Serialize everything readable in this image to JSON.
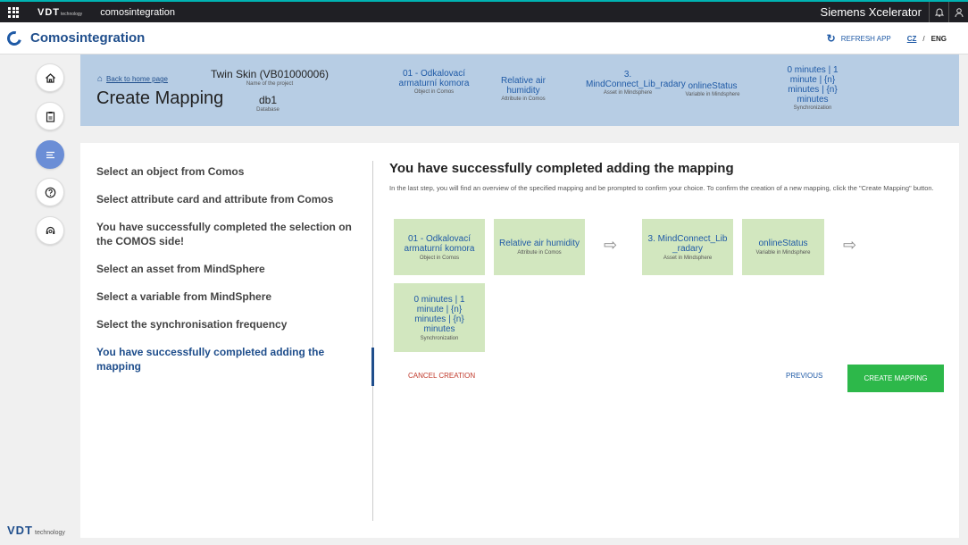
{
  "topbar": {
    "logo": "VDT",
    "logo_sub": "technology",
    "app_name": "comosintegration",
    "brand": "Siemens Xcelerator",
    "icons": [
      "grid-icon",
      "bell-icon",
      "user-icon"
    ]
  },
  "header": {
    "title": "Comosintegration",
    "refresh_label": "REFRESH APP",
    "lang_cz": "CZ",
    "lang_sep": "/",
    "lang_eng": "ENG"
  },
  "rail": {
    "icons": [
      "home-icon",
      "clipboard-icon",
      "list-icon",
      "help-icon",
      "support-icon"
    ]
  },
  "info": {
    "back_link": "Back to home page",
    "page_title": "Create Mapping",
    "project_value": "Twin Skin (VB01000006)",
    "project_label": "Name of the project",
    "db_value": "db1",
    "db_label": "Database",
    "object_value": "01 - Odkalovací armaturní komora",
    "object_label": "Object in Comos",
    "attribute_value": "Relative air humidity",
    "attribute_label": "Attribute in Comos",
    "asset_value": "3. MindConnect_Lib_radary",
    "asset_label": "Asset in Mindsphere",
    "variable_value": "onlineStatus",
    "variable_label": "Variable in Mindsphere",
    "sync_value": "0 minutes | 1 minute | {n} minutes | {n} minutes",
    "sync_label": "Synchronization"
  },
  "steps": [
    "Select an object from Comos",
    "Select attribute card and attribute from Comos",
    "You have successfully completed the selection on the COMOS side!",
    "Select an asset from MindSphere",
    "Select a variable from MindSphere",
    "Select the synchronisation frequency",
    "You have successfully completed adding the mapping"
  ],
  "content": {
    "title": "You have successfully completed adding the mapping",
    "description": "In the last step, you will find an overview of the specified mapping and be prompted to confirm your choice. To confirm the creation of a new mapping, click the \"Create Mapping\" button.",
    "tile_object_value": "01 - Odkalovací armaturní komora",
    "tile_object_label": "Object in Comos",
    "tile_attribute_value": "Relative air humidity",
    "tile_attribute_label": "Attribute in Comos",
    "tile_asset_value": "3. MindConnect_Lib _radary",
    "tile_asset_label": "Asset in Mindsphere",
    "tile_variable_value": "onlineStatus",
    "tile_variable_label": "Variable in Mindsphere",
    "tile_sync_value": "0 minutes | 1 minute | {n} minutes | {n} minutes",
    "tile_sync_label": "Synchronization",
    "arrow": "⇨",
    "cancel_label": "CANCEL CREATION",
    "previous_label": "PREVIOUS",
    "create_label": "CREATE MAPPING"
  },
  "footer": {
    "logo": "VDT",
    "logo_sub": "technology"
  },
  "colors": {
    "accent": "#1f4e8c",
    "panel": "#b7cde4",
    "tile": "#d2e7bf",
    "create_button": "#2db84a",
    "cancel": "#c0392b"
  }
}
